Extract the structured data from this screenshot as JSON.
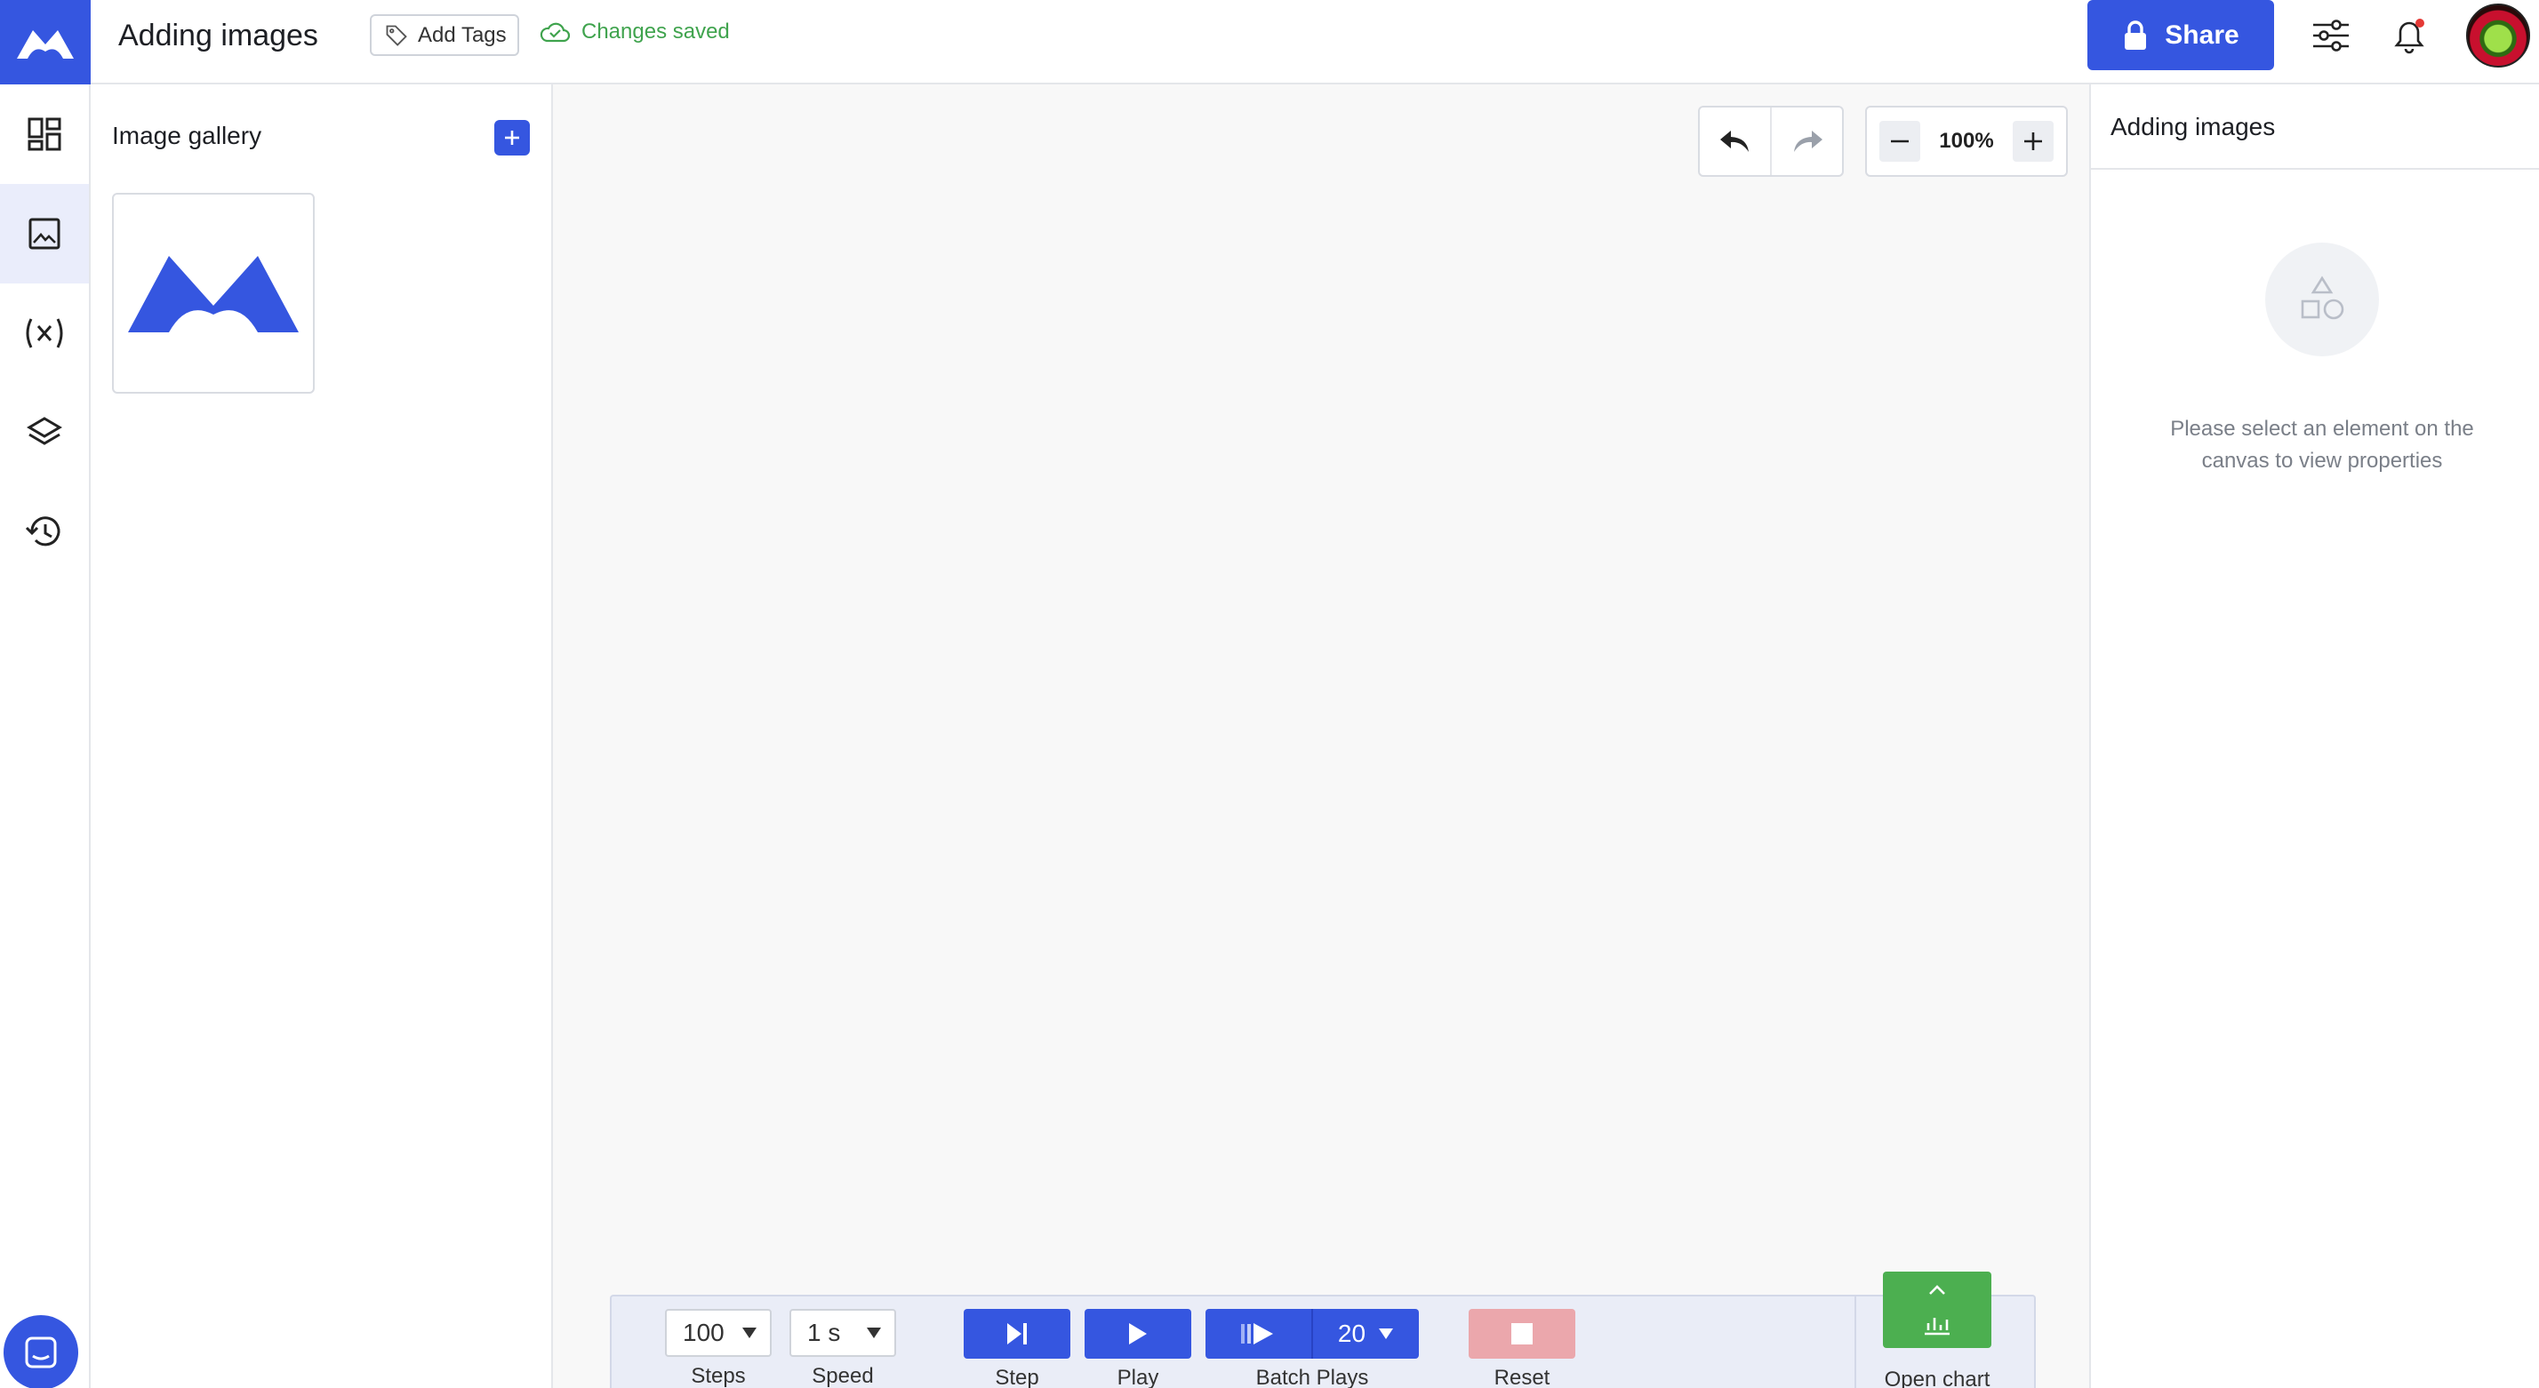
{
  "header": {
    "title": "Adding images",
    "add_tags_label": "Add Tags",
    "save_status": "Changes saved",
    "share_label": "Share"
  },
  "gallery": {
    "title": "Image gallery"
  },
  "canvas": {
    "zoom_label": "100%"
  },
  "player": {
    "steps_value": "100",
    "steps_label": "Steps",
    "speed_value": "1 s",
    "speed_label": "Speed",
    "step_label": "Step",
    "play_label": "Play",
    "batch_value": "20",
    "batch_label": "Batch Plays",
    "reset_label": "Reset",
    "chart_label": "Open chart"
  },
  "properties": {
    "title": "Adding images",
    "empty_message": "Please select an element on the canvas to view properties"
  },
  "colors": {
    "brand": "#3556e0",
    "success": "#3fa34d",
    "chart_button": "#4caf50",
    "reset_button": "#eba7ac",
    "notification_dot": "#e53935"
  },
  "icons": {
    "rail": [
      "dashboard-icon",
      "image-icon",
      "variable-icon",
      "layers-icon",
      "history-icon"
    ],
    "header": [
      "tag-icon",
      "cloud-check-icon",
      "lock-icon",
      "sliders-icon",
      "bell-icon"
    ]
  }
}
